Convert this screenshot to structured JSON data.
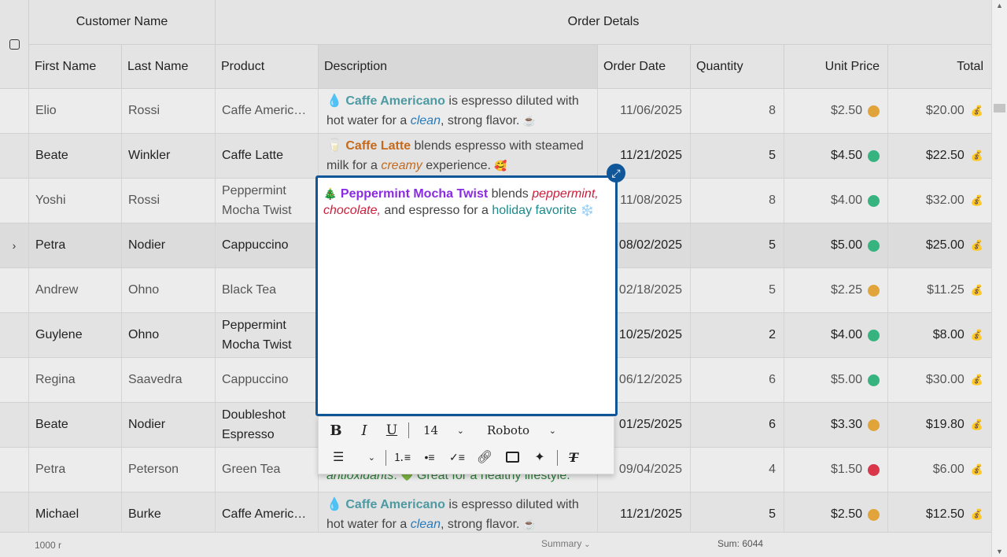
{
  "header": {
    "group_customer": "Customer Name",
    "group_order": "Order Detals",
    "columns": [
      "First Name",
      "Last Name",
      "Product",
      "Description",
      "Order Date",
      "Quantity",
      "Unit Price",
      "Total"
    ]
  },
  "rows": [
    {
      "first": "Elio",
      "last": "Rossi",
      "product": "Caffe Americ…",
      "date": "11/06/2025",
      "qty": "8",
      "price": "$2.50",
      "total": "$20.00",
      "dot": "#e0a43a"
    },
    {
      "first": "Beate",
      "last": "Winkler",
      "product": "Caffe Latte",
      "date": "11/21/2025",
      "qty": "5",
      "price": "$4.50",
      "total": "$22.50",
      "dot": "#36b37e"
    },
    {
      "first": "Yoshi",
      "last": "Rossi",
      "product": "Peppermint Mocha Twist",
      "date": "11/08/2025",
      "qty": "8",
      "price": "$4.00",
      "total": "$32.00",
      "dot": "#36b37e"
    },
    {
      "first": "Petra",
      "last": "Nodier",
      "product": "Cappuccino",
      "date": "08/02/2025",
      "qty": "5",
      "price": "$5.00",
      "total": "$25.00",
      "dot": "#36b37e"
    },
    {
      "first": "Andrew",
      "last": "Ohno",
      "product": "Black Tea",
      "date": "02/18/2025",
      "qty": "5",
      "price": "$2.25",
      "total": "$11.25",
      "dot": "#e0a43a"
    },
    {
      "first": "Guylene",
      "last": "Ohno",
      "product": "Peppermint Mocha Twist",
      "date": "10/25/2025",
      "qty": "2",
      "price": "$4.00",
      "total": "$8.00",
      "dot": "#36b37e"
    },
    {
      "first": "Regina",
      "last": "Saavedra",
      "product": "Cappuccino",
      "date": "06/12/2025",
      "qty": "6",
      "price": "$5.00",
      "total": "$30.00",
      "dot": "#36b37e"
    },
    {
      "first": "Beate",
      "last": "Nodier",
      "product": "Doubleshot Espresso",
      "date": "01/25/2025",
      "qty": "6",
      "price": "$3.30",
      "total": "$19.80",
      "dot": "#e0a43a"
    },
    {
      "first": "Petra",
      "last": "Peterson",
      "product": "Green Tea",
      "date": "09/04/2025",
      "qty": "4",
      "price": "$1.50",
      "total": "$6.00",
      "dot": "#d9364a"
    },
    {
      "first": "Michael",
      "last": "Burke",
      "product": "Caffe Americ…",
      "date": "11/21/2025",
      "qty": "5",
      "price": "$2.50",
      "total": "$12.50",
      "dot": "#e0a43a"
    }
  ],
  "descriptions": {
    "americano": {
      "icon": "💧",
      "name": "Caffe Americano",
      "t1": " is espresso diluted with hot water for a ",
      "em": "clean",
      "t2": ", strong flavor. ",
      "end": "☕"
    },
    "latte": {
      "icon": "🥛",
      "name": "Caffe Latte",
      "t1": " blends espresso with steamed milk for a ",
      "em": "creamy",
      "t2": " experience. ",
      "end": "🥰"
    },
    "greentea": {
      "em": "antioxidants",
      "t1": ". ",
      "heart": "💚",
      "t2": " Great for a healthy lifestyle."
    },
    "americano2": {
      "icon": "💧",
      "name": "Caffe Americano",
      "t1": " is espresso diluted with hot water for a ",
      "em": "clean",
      "t2": ", strong flavor. ",
      "end": "☕"
    }
  },
  "editor": {
    "icon": "🎄",
    "name": "Peppermint Mocha Twist",
    "t1": " blends ",
    "red": "peppermint, chocolate,",
    "t2": " and espresso for a ",
    "teal": "holiday favorite",
    "flake": "❄️",
    "font_size": "14",
    "font_name": "Roboto"
  },
  "footer": {
    "count": "1000 r",
    "summary": "Summary",
    "sum": "Sum: 6044"
  },
  "colors": {
    "accent": "#0f5799",
    "price_gold": "#e0a43a",
    "price_green": "#36b37e",
    "price_red": "#d9364a"
  }
}
